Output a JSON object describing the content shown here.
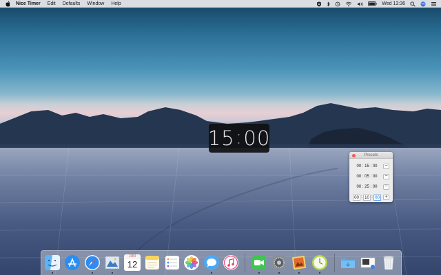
{
  "menubar": {
    "app_name": "Nice Timer",
    "items": [
      "Edit",
      "Defaults",
      "Window",
      "Help"
    ],
    "clock": "Wed 13:36"
  },
  "timer": {
    "minutes": "15",
    "seconds": "00"
  },
  "presets": {
    "title": "Presets",
    "rows": [
      {
        "time": "00 : 15 : 00",
        "action": "−"
      },
      {
        "time": "00 : 05 : 00",
        "action": "−"
      },
      {
        "time": "00 : 25 : 00",
        "action": "−"
      }
    ],
    "editor": {
      "hours": "00",
      "minutes": "10",
      "seconds": "00",
      "action": "+"
    }
  },
  "dock": {
    "calendar_month": "JUN",
    "calendar_day": "12",
    "apps": [
      "finder",
      "app-store",
      "safari",
      "mail",
      "calendar",
      "notes",
      "reminders",
      "photos",
      "messages",
      "music",
      "facetime",
      "system-preferences",
      "preview",
      "nice-timer",
      "downloads",
      "desktop-folder",
      "trash"
    ]
  },
  "colors": {
    "accent": "#1b6fd9",
    "close": "#fc5753",
    "timer_bg": "#101012"
  }
}
